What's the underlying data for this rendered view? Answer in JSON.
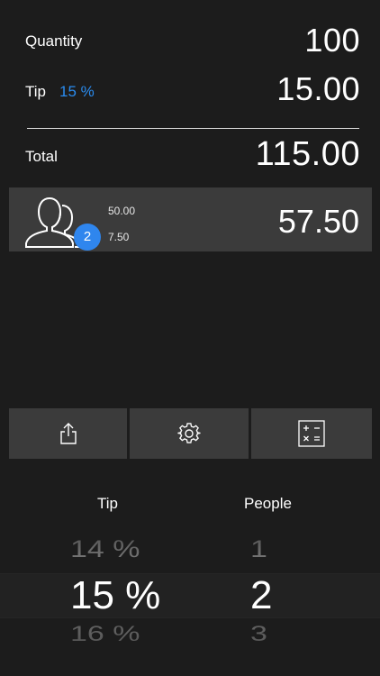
{
  "rows": {
    "quantity": {
      "label": "Quantity",
      "value": "100"
    },
    "tip": {
      "label": "Tip",
      "percent": "15 %",
      "value": "15.00"
    },
    "total": {
      "label": "Total",
      "value": "115.00"
    }
  },
  "split": {
    "people_count": "2",
    "share_base": "50.00",
    "share_tip": "7.50",
    "share_total": "57.50"
  },
  "toolbar": {
    "share_icon": "share-icon",
    "settings_icon": "gear-icon",
    "calculator_icon": "calculator-icon"
  },
  "picker": {
    "tip": {
      "header": "Tip",
      "above": "14 %",
      "selected": "15 %",
      "below": "16 %"
    },
    "people": {
      "header": "People",
      "above": "1",
      "selected": "2",
      "below": "3"
    }
  },
  "colors": {
    "accent": "#2a8cf0",
    "card": "#3b3b3b",
    "background": "#1c1c1c"
  }
}
